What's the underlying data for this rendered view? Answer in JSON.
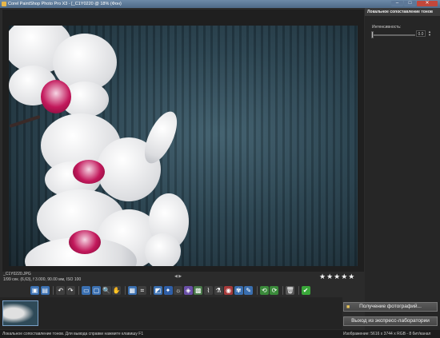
{
  "window": {
    "title": "Corel PaintShop Photo Pro X3 - [_C1Y0220 @  18% (Фон)",
    "controls": {
      "minimize": "–",
      "maximize": "□",
      "close": "✕"
    }
  },
  "panel": {
    "title": "Локальное сопоставление тонов",
    "intensity_label": "Интенсивность:",
    "intensity_value": "0.0",
    "intensity_level": 0
  },
  "image_info": {
    "filename": "_C1Y0220.JPG",
    "exif": "1/99 сек. (6,63), f 3.000, 90.00 мм, ISO 100",
    "nav": "◀ ▶",
    "rating_stars": "★★★★★"
  },
  "toolbar": {
    "icons": [
      "save-icon",
      "save-as-icon",
      "undo-icon",
      "redo-icon",
      "fit-icon",
      "actual-size-icon",
      "zoom-icon",
      "pan-icon",
      "compare-icon",
      "crop-icon",
      "straighten-icon",
      "auto-fix-icon",
      "brightness-icon",
      "white-balance-icon",
      "noise-icon",
      "clarity-icon",
      "sharpen-icon",
      "red-eye-icon",
      "makeover-icon",
      "retouch-icon",
      "rotate-left-icon",
      "rotate-right-icon",
      "delete-icon",
      "accept-icon"
    ],
    "glyphs": [
      "▣",
      "▤",
      "↶",
      "↷",
      "▭",
      "▢",
      "🔍",
      "✋",
      "▦",
      "⌗",
      "◩",
      "✦",
      "☼",
      "◈",
      "▩",
      "⌇",
      "⚗",
      "◉",
      "✾",
      "✎",
      "⟲",
      "⟳",
      "🗑",
      "✔"
    ],
    "colors": [
      "#3a6fb0",
      "#3a6fb0",
      "#3e3e3e",
      "#3e3e3e",
      "#3a6fb0",
      "#3a6fb0",
      "#3e3e3e",
      "#3e3e3e",
      "#3a6fb0",
      "#3e3e3e",
      "#3a6fb0",
      "#2f5fa8",
      "#3e3e3e",
      "#6a4fa8",
      "#4a7a4a",
      "#3e3e3e",
      "#3e3e3e",
      "#a83a3a",
      "#3a6fb0",
      "#3a6fb0",
      "#3a8a3a",
      "#3a8a3a",
      "#555555",
      "#3aa83a"
    ]
  },
  "buttons": {
    "get_photos": "Получение фотографий...",
    "exit_express_lab": "Выход из экспресс-лаборатории"
  },
  "status": {
    "help": "Локальное сопоставление тонов. Для вывода справки нажмите клавишу F1",
    "image_info": "Изображение: 5616 x 3744 x RGB - 8 бит/канал"
  }
}
